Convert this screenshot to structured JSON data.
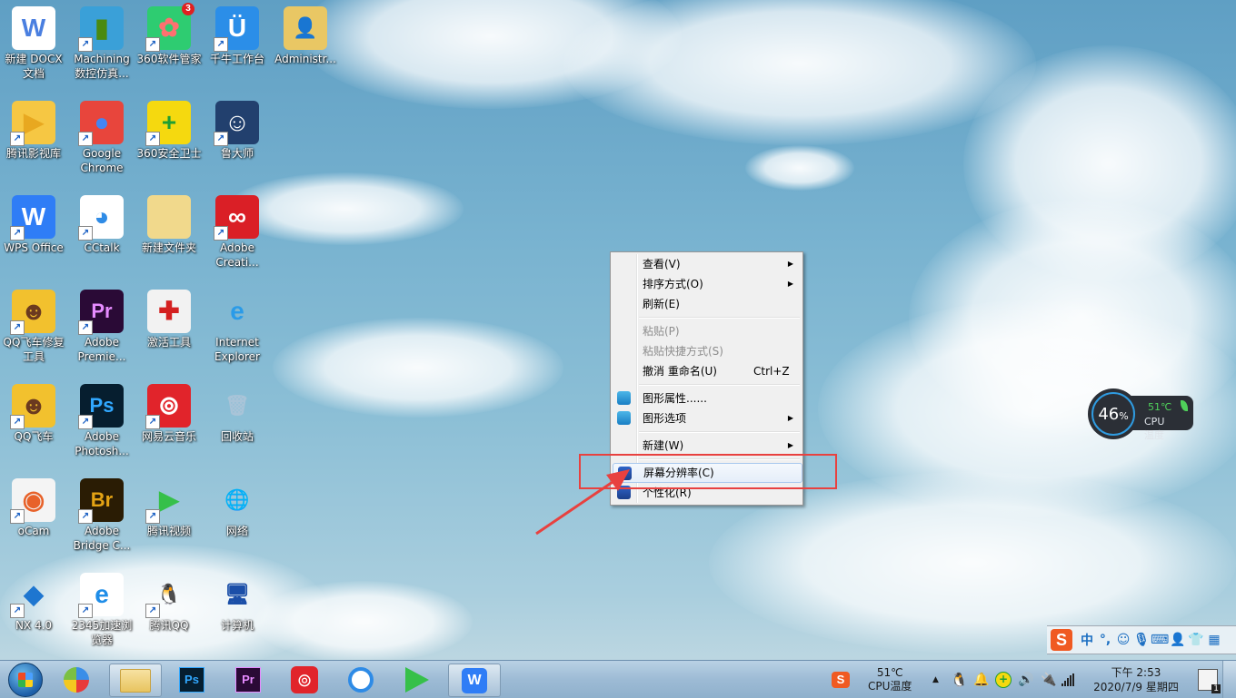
{
  "desktop": {
    "icons": [
      {
        "label": "新建 DOCX\n文档",
        "glyph": "W",
        "icon": "word-document-icon",
        "bg": "#ffffff",
        "fg": "#4a7fe0",
        "shortcut": false
      },
      {
        "label": "Machining\n数控仿真...",
        "glyph": "▮",
        "icon": "machining-sim-icon",
        "bg": "#3aa0d8",
        "fg": "#4a8a10",
        "shortcut": true
      },
      {
        "label": "360软件管家",
        "glyph": "✿",
        "icon": "360-software-manager-icon",
        "bg": "#2ecc71",
        "fg": "#ff7070",
        "shortcut": true,
        "badge": "3"
      },
      {
        "label": "千牛工作台",
        "glyph": "Ü",
        "icon": "qianniu-icon",
        "bg": "#2b8ee8",
        "fg": "#ffffff",
        "shortcut": true
      },
      {
        "label": "Administr...",
        "glyph": "👤",
        "icon": "user-folder-icon",
        "bg": "#e9c764",
        "fg": "#2a6a2a",
        "shortcut": false
      },
      {
        "label": "腾讯影视库",
        "glyph": "▶",
        "icon": "tencent-video-library-icon",
        "bg": "#f6c743",
        "fg": "#e8a820",
        "shortcut": true
      },
      {
        "label": "Google\nChrome",
        "glyph": "●",
        "icon": "chrome-icon",
        "bg": "#e8453c",
        "fg": "#4285f4",
        "shortcut": true
      },
      {
        "label": "360安全卫士",
        "glyph": "+",
        "icon": "360-security-icon",
        "bg": "#f5d90f",
        "fg": "#1f9e33",
        "shortcut": true
      },
      {
        "label": "鲁大师",
        "glyph": "☺",
        "icon": "ludashi-icon",
        "bg": "#22406e",
        "fg": "#ffffff",
        "shortcut": true
      },
      {
        "label": "WPS Office",
        "glyph": "W",
        "icon": "wps-office-icon",
        "bg": "#2f7df6",
        "fg": "#ffffff",
        "shortcut": true
      },
      {
        "label": "CCtalk",
        "glyph": "◕",
        "icon": "cctalk-icon",
        "bg": "#ffffff",
        "fg": "#2e8be6",
        "shortcut": true
      },
      {
        "label": "新建文件夹",
        "glyph": "",
        "icon": "folder-icon",
        "bg": "#f1d98c",
        "fg": "#ffffff",
        "shortcut": false
      },
      {
        "label": "Adobe\nCreati...",
        "glyph": "∞",
        "icon": "adobe-creative-cloud-icon",
        "bg": "#da1f26",
        "fg": "#ffffff",
        "shortcut": true
      },
      {
        "label": "QQ飞车修复\n工具",
        "glyph": "☻",
        "icon": "qq-speed-repair-icon",
        "bg": "#f2c12e",
        "fg": "#6b3a1f",
        "shortcut": true
      },
      {
        "label": "Adobe\nPremie...",
        "glyph": "Pr",
        "icon": "premiere-icon",
        "bg": "#2a0a36",
        "fg": "#e68cff",
        "shortcut": true
      },
      {
        "label": "激活工具",
        "glyph": "✚",
        "icon": "activation-tool-icon",
        "bg": "#f2f2f2",
        "fg": "#d42020",
        "shortcut": false
      },
      {
        "label": "Internet\nExplorer",
        "glyph": "e",
        "icon": "internet-explorer-icon",
        "bg": "transparent",
        "fg": "#2a9be8",
        "shortcut": false
      },
      {
        "label": "QQ飞车",
        "glyph": "☻",
        "icon": "qq-speed-icon",
        "bg": "#f2c12e",
        "fg": "#6b3a1f",
        "shortcut": true
      },
      {
        "label": "Adobe\nPhotosh...",
        "glyph": "Ps",
        "icon": "photoshop-icon",
        "bg": "#061e2f",
        "fg": "#31a8ff",
        "shortcut": true
      },
      {
        "label": "网易云音乐",
        "glyph": "⊚",
        "icon": "netease-music-icon",
        "bg": "#e1242b",
        "fg": "#ffffff",
        "shortcut": true
      },
      {
        "label": "回收站",
        "glyph": "🗑",
        "icon": "recycle-bin-icon",
        "bg": "transparent",
        "fg": "#a9c4d8",
        "shortcut": false
      },
      {
        "label": "oCam",
        "glyph": "◉",
        "icon": "ocam-icon",
        "bg": "#f4f4f4",
        "fg": "#e8622a",
        "shortcut": true
      },
      {
        "label": "Adobe\nBridge C...",
        "glyph": "Br",
        "icon": "bridge-icon",
        "bg": "#2a1c04",
        "fg": "#e4a314",
        "shortcut": true
      },
      {
        "label": "腾讯视频",
        "glyph": "▶",
        "icon": "tencent-video-icon",
        "bg": "transparent",
        "fg": "#36c04a",
        "shortcut": true
      },
      {
        "label": "网络",
        "glyph": "🌐",
        "icon": "network-icon",
        "bg": "transparent",
        "fg": "#1c4fbf",
        "shortcut": false
      },
      {
        "label": "NX 4.0",
        "glyph": "◆",
        "icon": "nx-icon",
        "bg": "transparent",
        "fg": "#1e76d0",
        "shortcut": true
      },
      {
        "label": "2345加速浏\n览器",
        "glyph": "e",
        "icon": "2345-browser-icon",
        "bg": "#ffffff",
        "fg": "#1e8de8",
        "shortcut": true
      },
      {
        "label": "腾讯QQ",
        "glyph": "🐧",
        "icon": "qq-icon",
        "bg": "transparent",
        "fg": "#000000",
        "shortcut": true
      },
      {
        "label": "计算机",
        "glyph": "🖥",
        "icon": "computer-icon",
        "bg": "transparent",
        "fg": "#1b4fa8",
        "shortcut": false
      }
    ]
  },
  "context_menu": {
    "items": [
      {
        "label": "查看(V)",
        "submenu": true,
        "disabled": false
      },
      {
        "label": "排序方式(O)",
        "submenu": true,
        "disabled": false
      },
      {
        "label": "刷新(E)",
        "submenu": false,
        "disabled": false
      },
      {
        "label": "粘贴(P)",
        "submenu": false,
        "disabled": true
      },
      {
        "label": "粘贴快捷方式(S)",
        "submenu": false,
        "disabled": true
      },
      {
        "label": "撤消 重命名(U)",
        "shortcut": "Ctrl+Z",
        "submenu": false,
        "disabled": false
      },
      {
        "label": "图形属性......",
        "submenu": false,
        "disabled": false,
        "icon": "graphics-properties-icon"
      },
      {
        "label": "图形选项",
        "submenu": true,
        "disabled": false,
        "icon": "graphics-options-icon"
      },
      {
        "label": "新建(W)",
        "submenu": true,
        "disabled": false
      },
      {
        "label": "屏幕分辨率(C)",
        "submenu": false,
        "disabled": false,
        "highlighted": true,
        "icon": "screen-resolution-icon"
      },
      {
        "label": "个性化(R)",
        "submenu": false,
        "disabled": false,
        "icon": "personalize-icon"
      }
    ]
  },
  "cpu_widget": {
    "usage": "46",
    "usage_unit": "%",
    "usage_fraction": 0.46,
    "temp": "51℃",
    "temp_label": "CPU温度"
  },
  "ime_bar": {
    "mode": "中",
    "punct": "°,",
    "items": [
      "emoji-icon",
      "microphone-icon",
      "keyboard-icon",
      "user-card-icon",
      "skin-icon",
      "toolbox-icon"
    ]
  },
  "taskbar": {
    "apps": [
      {
        "name": "start-button",
        "glyph": "⊞"
      },
      {
        "name": "app-360",
        "glyph": "✿"
      },
      {
        "name": "explorer",
        "glyph": "📁",
        "active": true
      },
      {
        "name": "photoshop",
        "glyph": "Ps"
      },
      {
        "name": "premiere",
        "glyph": "Pr"
      },
      {
        "name": "netease-music",
        "glyph": "⊚"
      },
      {
        "name": "cctalk",
        "glyph": "◕"
      },
      {
        "name": "tencent-video",
        "glyph": "▶"
      },
      {
        "name": "wps",
        "glyph": "W",
        "active": true
      }
    ],
    "tray": {
      "cpu_temp": "51℃",
      "cpu_label": "CPU温度",
      "time": "下午 2:53",
      "date": "2020/7/9 星期四",
      "notification_count": "1"
    }
  },
  "colors": {
    "annotation_red": "#e8413f",
    "menu_highlight_border": "#a8c8ee",
    "widget_ring": "#2f9be0",
    "widget_temp_green": "#4fd05a"
  }
}
